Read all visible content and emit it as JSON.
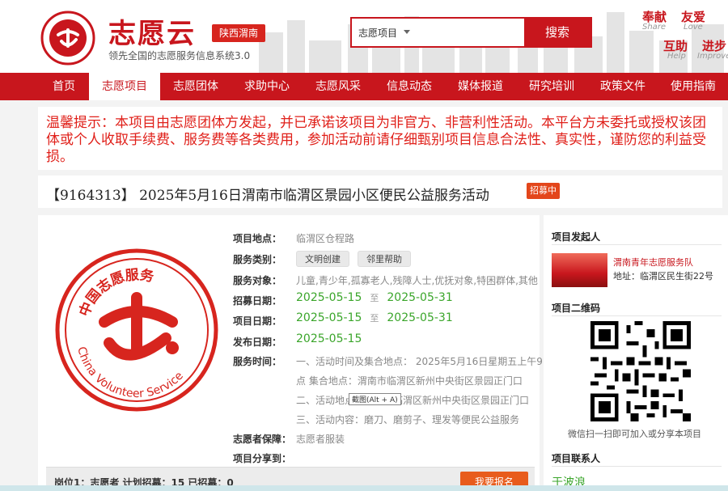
{
  "header": {
    "brand": "志愿云",
    "region": "陕西渭南",
    "slogan": "领先全国的志愿服务信息系统3.0",
    "logo_text": "中国志愿服务",
    "search": {
      "category": "志愿项目",
      "button": "搜索"
    },
    "right_slogans": [
      {
        "cn": "奉献",
        "en": "Share"
      },
      {
        "cn": "友爱",
        "en": "Love"
      },
      {
        "cn": "互助",
        "en": "Help"
      },
      {
        "cn": "进步",
        "en": "Improve"
      }
    ]
  },
  "nav": {
    "items": [
      "首页",
      "志愿项目",
      "志愿团体",
      "求助中心",
      "志愿风采",
      "信息动态",
      "媒体报道",
      "研究培训",
      "政策文件",
      "使用指南"
    ],
    "active_index": 1
  },
  "notice": "温馨提示：本项目由志愿团体方发起，并已承诺该项目为非官方、非营利性活动。本平台方未委托或授权该团体或个人收取手续费、服务费等各类费用，参加活动前请仔细甄别项目信息合法性、真实性，谨防您的利益受损。",
  "project": {
    "title": "【9164313】 2025年5月16日渭南市临渭区景园小区便民公益服务活动",
    "status": "招募中",
    "logo_texts": [
      "中国志愿服务",
      "China Volunteer Service"
    ],
    "location_label": "项目地点：",
    "location": "临渭区仓程路",
    "category_label": "服务类别：",
    "categories": [
      "文明创建",
      "邻里帮助"
    ],
    "target_label": "服务对象：",
    "target": "儿童,青少年,孤寡老人,残障人士,优抚对象,特困群体,其他",
    "recruit_label": "招募日期：",
    "recruit_start": "2025-05-15",
    "recruit_end": "2025-05-31",
    "project_date_label": "项目日期：",
    "project_start": "2025-05-15",
    "project_end": "2025-05-31",
    "publish_label": "发布日期：",
    "publish_date": "2025-05-15",
    "date_sep": "至",
    "service_time_label": "服务时间：",
    "service_time_lines": [
      "一、活动时间及集合地点： 2025年5月16日星期五上午9",
      "点 集合地点：渭南市临渭区新州中央街区景园正门口",
      "二、活动地点：渭南市临渭区新州中央街区景园正门口",
      "三、活动内容：磨刀、磨剪子、理发等便民公益服务"
    ],
    "guarantee_label": "志愿者保障：",
    "guarantee": "志愿者服装",
    "share_label": "项目分享到：",
    "tooltip": "截图(Alt + A)",
    "position_summary": "岗位1：志愿者   计划招募：15   已招募：0",
    "signup_button": "我要报名"
  },
  "sidebar": {
    "initiator_title": "项目发起人",
    "org_name": "渭南青年志愿服务队",
    "org_address": "地址：临渭区民生街22号",
    "qr_title": "项目二维码",
    "qr_caption": "微信扫一扫即可加入或分享本项目",
    "contact_title": "项目联系人",
    "contact_name": "于波浪"
  },
  "colors": {
    "brand_red": "#c8161d",
    "green": "#3aa52a",
    "orange": "#e85c1c"
  }
}
